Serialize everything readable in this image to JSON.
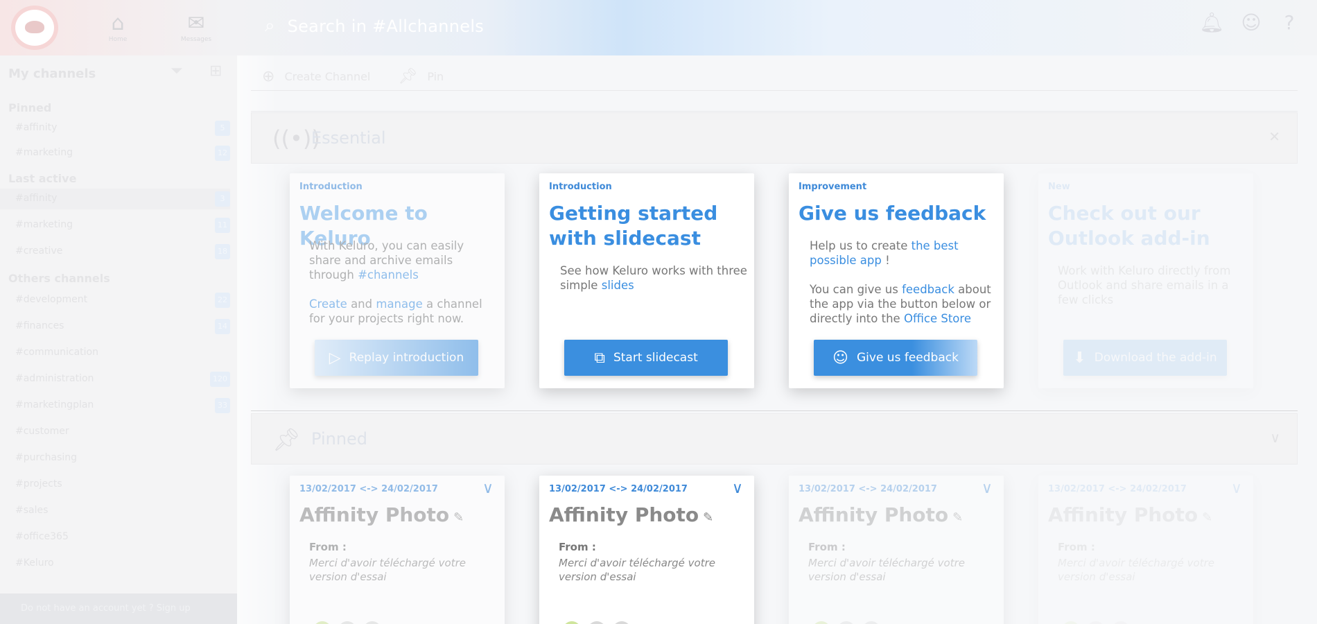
{
  "app": {
    "search_text": "Search in #Allchannels"
  },
  "topnav": [
    {
      "label": "Home",
      "icon": "home-icon"
    },
    {
      "label": "Messages",
      "icon": "mail-icon"
    }
  ],
  "toprightIcons": [
    "notification-icon",
    "profile-icon",
    "help-icon"
  ],
  "sidebar": {
    "header": "My channels",
    "sections": {
      "pinned": "Pinned",
      "last_active": "Last active",
      "others": "Others channels"
    },
    "pinned_items": [
      {
        "name": "#affinity",
        "badge": "5"
      },
      {
        "name": "#marketing",
        "badge": "12"
      }
    ],
    "last_active_items": [
      {
        "name": "#affinity",
        "badge": "3"
      },
      {
        "name": "#marketing",
        "badge": "11"
      },
      {
        "name": "#creative",
        "badge": "18"
      }
    ],
    "other_items": [
      {
        "name": "#development",
        "badge": "22"
      },
      {
        "name": "#finances",
        "badge": "14"
      },
      {
        "name": "#communication",
        "badge": ""
      },
      {
        "name": "#administration",
        "badge": "120"
      },
      {
        "name": "#marketingplan",
        "badge": "33"
      },
      {
        "name": "#customer",
        "badge": ""
      },
      {
        "name": "#purchasing",
        "badge": ""
      },
      {
        "name": "#projects",
        "badge": ""
      },
      {
        "name": "#sales",
        "badge": ""
      },
      {
        "name": "#office365",
        "badge": ""
      },
      {
        "name": "#Keluro",
        "badge": ""
      }
    ],
    "footer": "Do not have an account yet ? Sign up"
  },
  "toolbar": {
    "create_label": "Create Channel",
    "pin_label": "Pin"
  },
  "sections": {
    "essential_title": "Essential",
    "pinned_title": "Pinned"
  },
  "cards": [
    {
      "category": "Introduction",
      "title": "Welcome to Keluro",
      "desc_parts": [
        "With Keluro, you can easily share and archive emails through ",
        "#channels"
      ],
      "desc2_parts": [
        "Create",
        " and ",
        "manage",
        " a channel for your projects right now."
      ],
      "button": "Replay introduction"
    },
    {
      "category": "Introduction",
      "title": "Getting started with slidecast",
      "desc_parts": [
        "See how Keluro works with three simple ",
        "slides"
      ],
      "button": "Start slidecast"
    },
    {
      "category": "Improvement",
      "title": "Give us feedback",
      "desc_parts": [
        "Help us to create ",
        "the best possible app",
        " !"
      ],
      "desc2_parts": [
        "You can give us ",
        "feedback",
        " about the app via the button below or directly into the ",
        "Office Store"
      ],
      "button": "Give us feedback"
    },
    {
      "category": "New",
      "title": "Check out our Outlook add-in",
      "desc": "Work with Keluro directly from Outlook and share emails in a few clicks",
      "button": "Download the add-in"
    }
  ],
  "pinned_cards": [
    {
      "dates": "13/02/2017 <-> 24/02/2017",
      "title": "Affinity Photo",
      "from": "From :",
      "msg": "Merci d'avoir téléchargé votre version d'essai"
    },
    {
      "dates": "13/02/2017 <-> 24/02/2017",
      "title": "Affinity Photo",
      "from": "From :",
      "msg": "Merci d'avoir téléchargé votre version d'essai"
    },
    {
      "dates": "13/02/2017 <-> 24/02/2017",
      "title": "Affinity Photo",
      "from": "From :",
      "msg": "Merci d'avoir téléchargé votre version d'essai"
    },
    {
      "dates": "13/02/2017 <-> 24/02/2017",
      "title": "Affinity Photo",
      "from": "From :",
      "msg": "Merci d'avoir téléchargé votre version d'essai"
    }
  ],
  "colors": {
    "accent": "#3b8fdf",
    "text": "#777777"
  }
}
